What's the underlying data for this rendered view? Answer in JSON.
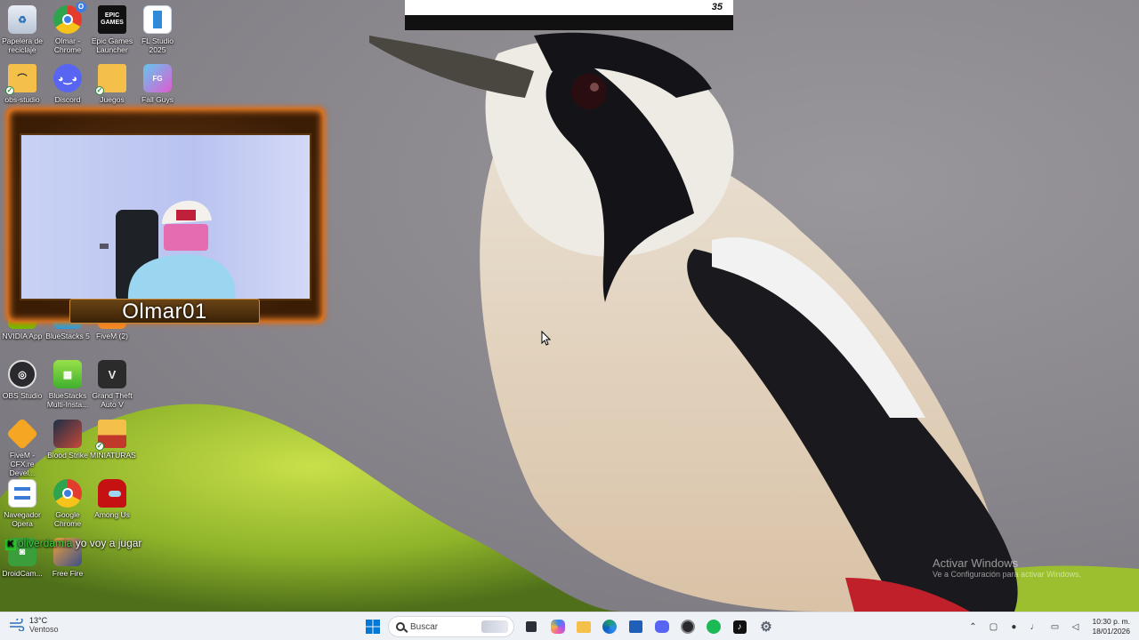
{
  "desktop": {
    "icons": [
      {
        "label": "Papelera de reciclaje",
        "icon": "recycle-bin-icon"
      },
      {
        "label": "Olmar - Chrome",
        "icon": "chrome-icon",
        "badge": "O"
      },
      {
        "label": "Epic Games Launcher",
        "icon": "epic-games-icon",
        "glyph": "EPIC GAMES"
      },
      {
        "label": "FL Studio 2025",
        "icon": "fl-studio-icon"
      },
      {
        "label": "obs-studio",
        "icon": "folder-icon"
      },
      {
        "label": "Discord",
        "icon": "discord-icon"
      },
      {
        "label": "Juegos",
        "icon": "folder-icon"
      },
      {
        "label": "Fall Guys",
        "icon": "fall-guys-icon"
      },
      {
        "label": "NVIDIA App",
        "icon": "nvidia-icon"
      },
      {
        "label": "BlueStacks 5",
        "icon": "bluestacks-icon"
      },
      {
        "label": "FiveM (2)",
        "icon": "fivem-icon"
      },
      {
        "label": "OBS Studio",
        "icon": "obs-icon"
      },
      {
        "label": "BlueStacks Multi-Insta...",
        "icon": "bluestacks-multi-icon"
      },
      {
        "label": "Grand Theft Auto V",
        "icon": "gta-icon"
      },
      {
        "label": "FiveM - CFX.re Devel...",
        "icon": "fivem-icon"
      },
      {
        "label": "Blood Strike",
        "icon": "blood-strike-icon"
      },
      {
        "label": "MINIATURAS",
        "icon": "folder-icon"
      },
      {
        "label": "Navegador Opera",
        "icon": "opera-icon"
      },
      {
        "label": "Google Chrome",
        "icon": "chrome-icon"
      },
      {
        "label": "Among Us",
        "icon": "among-us-icon"
      },
      {
        "label": "DroidCam...",
        "icon": "droidcam-icon"
      },
      {
        "label": "Free Fire",
        "icon": "free-fire-icon"
      }
    ]
  },
  "overlay": {
    "banner_number": "35",
    "streamer_name": "Olmar01",
    "chat": {
      "badge": "K",
      "user": "oliverdamia",
      "message": "yo voy a jugar"
    }
  },
  "watermark": {
    "line1": "Activar Windows",
    "line2": "Ve a Configuración para activar Windows."
  },
  "taskbar": {
    "weather": {
      "temp": "13°C",
      "desc": "Ventoso"
    },
    "search_placeholder": "Buscar",
    "apps": [
      "start-icon",
      "file-manager-icon",
      "copilot-icon",
      "file-explorer-icon",
      "edge-icon",
      "store-icon",
      "discord-icon",
      "obs-icon",
      "spotify-icon",
      "tiktok-icon",
      "settings-icon"
    ],
    "clock": {
      "time": "10:30 p. m.",
      "date": "18/01/2026"
    }
  },
  "colors": {
    "accent": "#0078d4",
    "chat_user": "#3bd43b",
    "webcam_glow": "#ff8a2a"
  }
}
